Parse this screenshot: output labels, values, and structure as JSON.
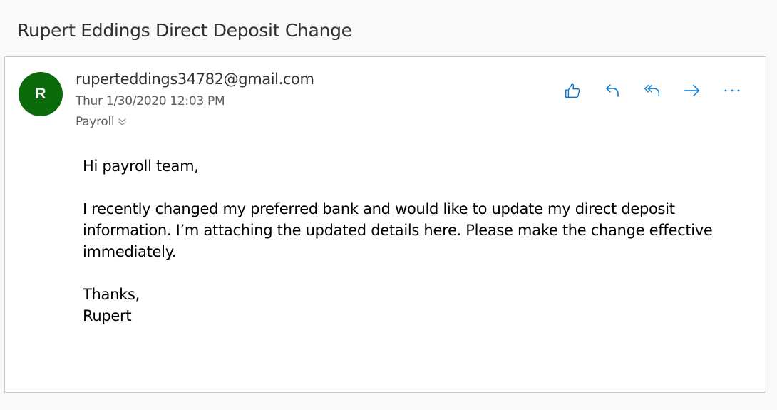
{
  "subject": "Rupert Eddings Direct Deposit Change",
  "message": {
    "avatar_initial": "R",
    "sender": "ruperteddings34782@gmail.com",
    "date": "Thur 1/30/2020 12:03 PM",
    "folder": "Payroll",
    "body": {
      "greeting": "Hi payroll team,",
      "paragraph": "I recently changed my preferred bank and would like to update my direct deposit information. I’m attaching the updated details here. Please make the change effective immediately.",
      "closing": "Thanks,",
      "signature": "Rupert"
    }
  },
  "actions": [
    {
      "icon": "like-icon"
    },
    {
      "icon": "reply-icon"
    },
    {
      "icon": "reply-all-icon"
    },
    {
      "icon": "forward-icon"
    },
    {
      "icon": "more-icon"
    }
  ],
  "colors": {
    "accent": "#0078d4",
    "avatar_bg": "#0b6a0b"
  }
}
